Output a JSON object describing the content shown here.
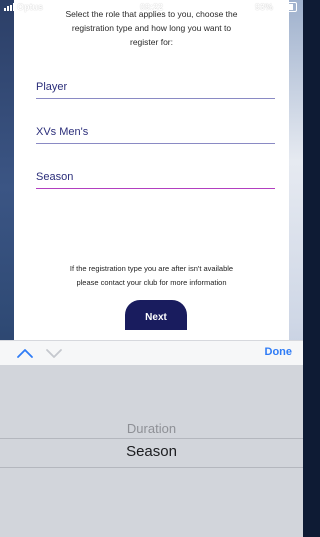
{
  "status_bar": {
    "carrier": "Optus",
    "time": "09:22",
    "battery": "93%"
  },
  "intro_text": [
    "Select the role that applies to you, choose the",
    "registration type and how long you want to",
    "register for:"
  ],
  "fields": {
    "role": "Player",
    "type": "XVs Men's",
    "duration": "Season"
  },
  "note": [
    "If the registration type you are after isn't available",
    "please contact your club for more information"
  ],
  "next_label": "Next",
  "toolbar": {
    "done_label": "Done"
  },
  "picker": {
    "items": [
      "Duration",
      "Season"
    ],
    "selected_index": 1
  },
  "colors": {
    "accent": "#2f7cf6",
    "button": "#191c5e",
    "active_underline": "#b23fc0",
    "field_text": "#2b2e7a"
  },
  "icons": {
    "prev": "chevron-up-icon",
    "next": "chevron-down-icon",
    "wifi": "wifi-icon",
    "location": "location-arrow-icon",
    "alarm": "alarm-icon"
  }
}
